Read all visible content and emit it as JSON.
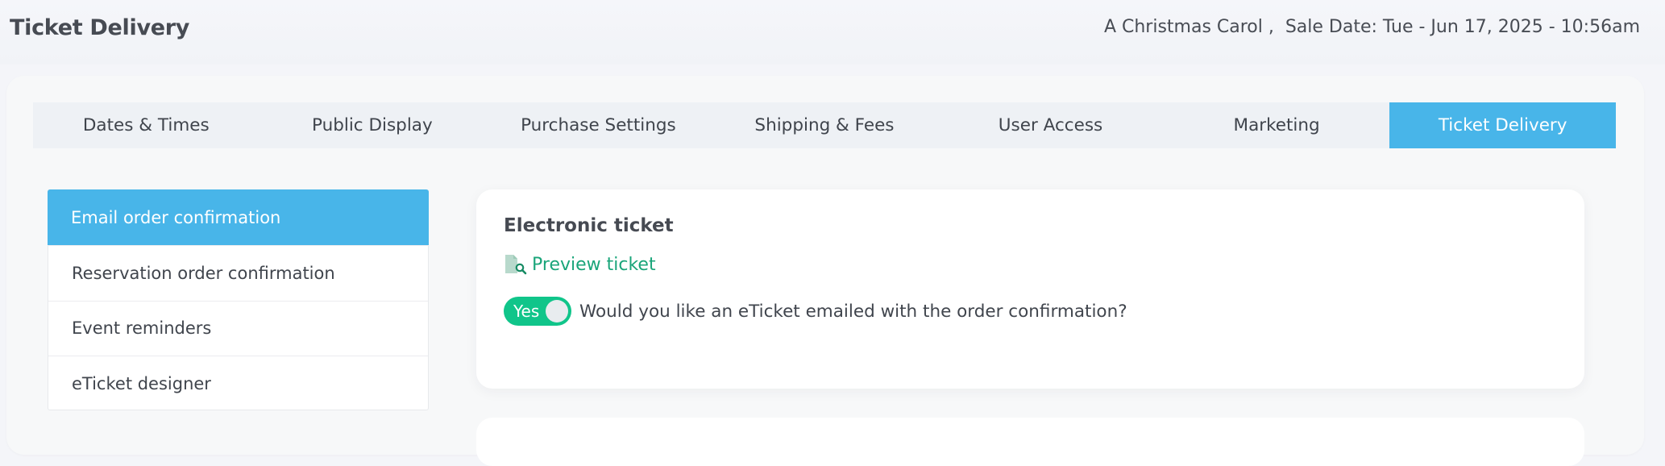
{
  "header": {
    "title": "Ticket Delivery",
    "event_info": "A Christmas Carol ,  Sale Date: Tue - Jun 17, 2025 - 10:56am"
  },
  "tabs": [
    {
      "label": "Dates & Times"
    },
    {
      "label": "Public Display"
    },
    {
      "label": "Purchase Settings"
    },
    {
      "label": "Shipping & Fees"
    },
    {
      "label": "User Access"
    },
    {
      "label": "Marketing"
    },
    {
      "label": "Ticket Delivery",
      "active": true
    }
  ],
  "sidebar": {
    "items": [
      {
        "label": "Email order confirmation",
        "active": true
      },
      {
        "label": "Reservation order confirmation"
      },
      {
        "label": "Event reminders"
      },
      {
        "label": "eTicket designer"
      }
    ]
  },
  "card": {
    "title": "Electronic ticket",
    "preview_label": "Preview ticket",
    "preview_icon": "file-search-icon",
    "toggle_label": "Yes",
    "toggle_state": true,
    "question": "Would you like an eTicket emailed with the order confirmation?"
  },
  "colors": {
    "accent": "#48b5e9",
    "toggle_on": "#10c58a",
    "link": "#1aa57a"
  }
}
